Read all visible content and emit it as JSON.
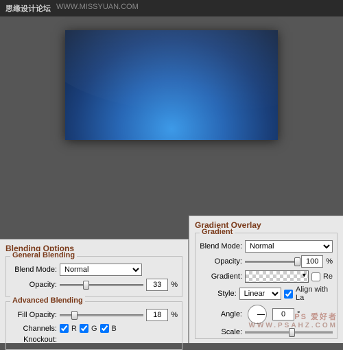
{
  "topbar": {
    "brand": "思缘设计论坛",
    "url": "WWW.MISSYUAN.COM"
  },
  "watermark1": "www.psahz.com",
  "watermark2": {
    "main": "PS 爱好者",
    "sub": "WWW.PSAHZ.COM"
  },
  "left": {
    "title": "Blending Options",
    "general": {
      "legend": "General Blending",
      "blend_mode_label": "Blend Mode:",
      "blend_mode_value": "Normal",
      "opacity_label": "Opacity:",
      "opacity_value": "33",
      "pct": "%"
    },
    "advanced": {
      "legend": "Advanced Blending",
      "fill_label": "Fill Opacity:",
      "fill_value": "18",
      "pct": "%",
      "channels_label": "Channels:",
      "ch_r": "R",
      "ch_g": "G",
      "ch_b": "B",
      "knockout_label": "Knockout:"
    }
  },
  "right": {
    "title": "Gradient Overlay",
    "fieldset_legend": "Gradient",
    "blend_mode_label": "Blend Mode:",
    "blend_mode_value": "Normal",
    "opacity_label": "Opacity:",
    "opacity_value": "100",
    "pct": "%",
    "gradient_label": "Gradient:",
    "reverse_label": "Re",
    "style_label": "Style:",
    "style_value": "Linear",
    "align_label": "Align with La",
    "angle_label": "Angle:",
    "angle_value": "0",
    "deg": "°",
    "scale_label": "Scale:"
  }
}
